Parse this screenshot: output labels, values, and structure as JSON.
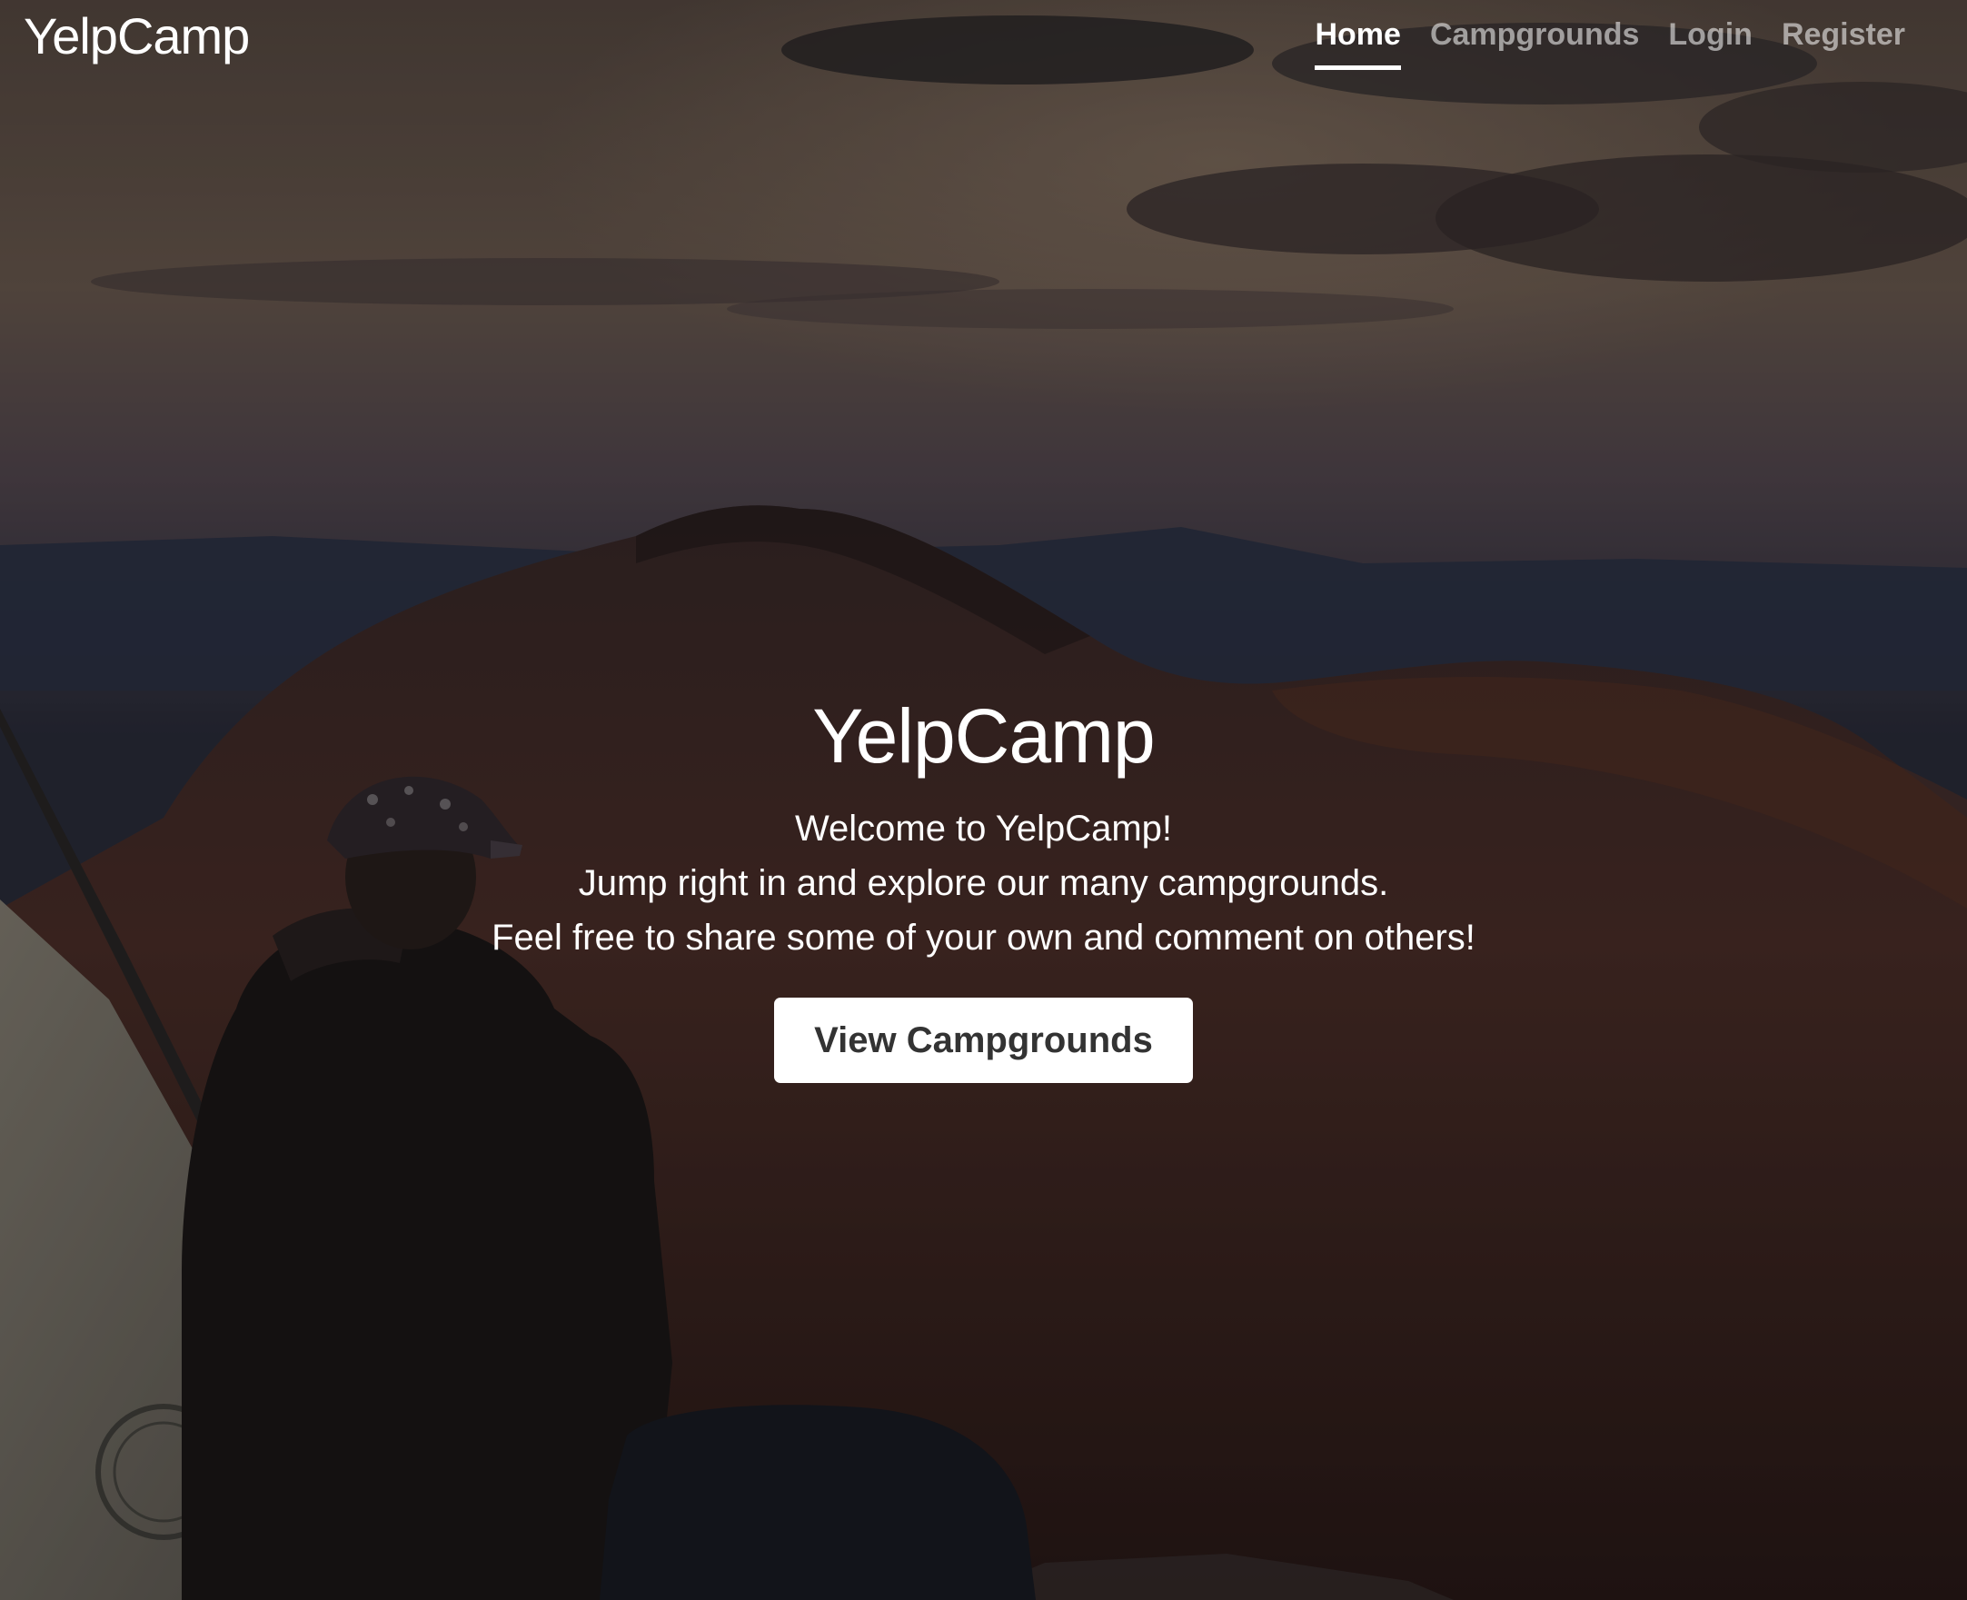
{
  "header": {
    "brand": "YelpCamp",
    "nav": [
      {
        "label": "Home",
        "active": true
      },
      {
        "label": "Campgrounds",
        "active": false
      },
      {
        "label": "Login",
        "active": false
      },
      {
        "label": "Register",
        "active": false
      }
    ]
  },
  "hero": {
    "title": "YelpCamp",
    "lines": [
      "Welcome to YelpCamp!",
      "Jump right in and explore our many campgrounds.",
      "Feel free to share some of your own and comment on others!"
    ],
    "cta_label": "View Campgrounds"
  },
  "colors": {
    "text": "#ffffff",
    "nav_inactive": "rgba(255,255,255,0.55)",
    "button_bg": "#ffffff",
    "button_text": "#333333"
  }
}
